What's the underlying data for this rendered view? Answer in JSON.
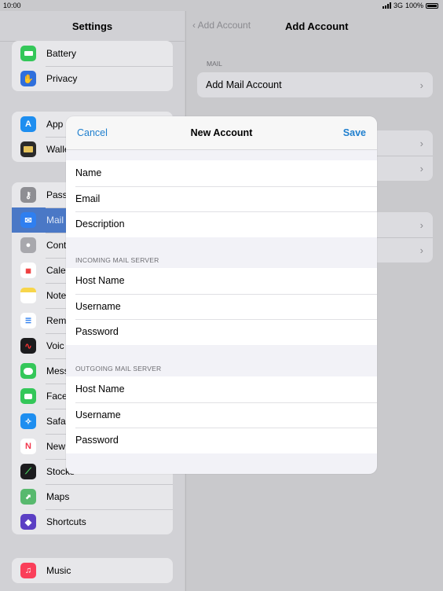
{
  "status": {
    "time": "10:00",
    "network": "3G",
    "battery": "100%"
  },
  "sidebar": {
    "title": "Settings",
    "groups": [
      {
        "items": [
          {
            "label": "Battery",
            "icon": "battery-icon",
            "color": "#34c759"
          },
          {
            "label": "Privacy",
            "icon": "hand-icon",
            "color": "#2f6fdc"
          }
        ]
      },
      {
        "items": [
          {
            "label": "App",
            "icon": "app-store-icon",
            "color": "#1e8ef0"
          },
          {
            "label": "Walle",
            "icon": "wallet-icon",
            "color": "#2b2b2b"
          }
        ]
      },
      {
        "items": [
          {
            "label": "Pass",
            "icon": "key-icon",
            "color": "#8e8e93"
          },
          {
            "label": "Mail",
            "icon": "envelope-icon",
            "color": "#2f7ff0",
            "selected": true
          },
          {
            "label": "Cont",
            "icon": "contacts-icon",
            "color": "#a8a8ad"
          },
          {
            "label": "Cale",
            "icon": "calendar-icon",
            "color": "#ffffff"
          },
          {
            "label": "Note",
            "icon": "notes-icon",
            "color": "#f7d54b"
          },
          {
            "label": "Rem",
            "icon": "reminders-icon",
            "color": "#ffffff"
          },
          {
            "label": "Voic",
            "icon": "voice-memos-icon",
            "color": "#1c1c1e"
          },
          {
            "label": "Mess",
            "icon": "messages-icon",
            "color": "#34c759"
          },
          {
            "label": "Face",
            "icon": "facetime-icon",
            "color": "#34c759"
          },
          {
            "label": "Safa",
            "icon": "safari-icon",
            "color": "#1e8ef0"
          },
          {
            "label": "New",
            "icon": "news-icon",
            "color": "#ffffff"
          },
          {
            "label": "Stocks",
            "icon": "stocks-icon",
            "color": "#1c1c1e"
          },
          {
            "label": "Maps",
            "icon": "maps-icon",
            "color": "#58b96e"
          },
          {
            "label": "Shortcuts",
            "icon": "shortcuts-icon",
            "color": "#5b3fc4"
          }
        ]
      },
      {
        "items": [
          {
            "label": "Music",
            "icon": "music-icon",
            "color": "#fa3f5a"
          }
        ]
      }
    ]
  },
  "detail": {
    "back_label": "Add Account",
    "title": "Add Account",
    "mail_caption": "MAIL",
    "add_mail_label": "Add Mail Account"
  },
  "modal": {
    "cancel_label": "Cancel",
    "title": "New Account",
    "save_label": "Save",
    "account_fields": [
      "Name",
      "Email",
      "Description"
    ],
    "incoming_caption": "INCOMING MAIL SERVER",
    "incoming_fields": [
      "Host Name",
      "Username",
      "Password"
    ],
    "outgoing_caption": "OUTGOING MAIL SERVER",
    "outgoing_fields": [
      "Host Name",
      "Username",
      "Password"
    ]
  }
}
